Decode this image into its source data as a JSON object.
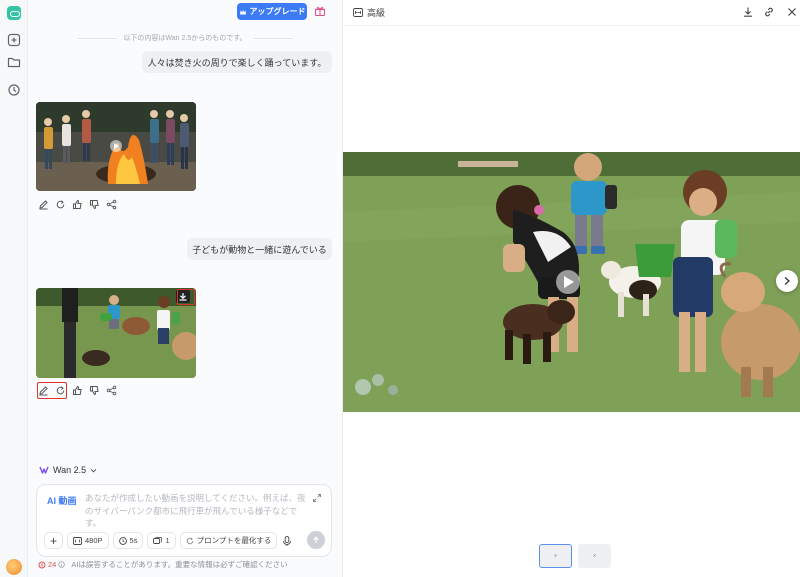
{
  "rail": {
    "icons": [
      "logo-icon",
      "new-chat-icon",
      "folder-icon",
      "history-icon"
    ]
  },
  "header": {
    "upgrade_label": "アップグレード"
  },
  "chat": {
    "notice": "以下の内容はWan 2.5からのものです。",
    "messages": [
      {
        "role": "user",
        "text": "人々は焚き火の周りで楽しく踊っています。"
      },
      {
        "role": "assistant",
        "type": "video",
        "scene": "bonfire-dance"
      },
      {
        "role": "user",
        "text": "子どもが動物と一緒に遊んでいる"
      },
      {
        "role": "assistant",
        "type": "video",
        "scene": "children-with-goats"
      }
    ]
  },
  "composer": {
    "model_label": "Wan 2.5",
    "mode_label": "AI 動画",
    "placeholder": "あなたが作成したい動画を説明してください。例えば、夜のサイバーパンク都市に飛行車が飛んでいる様子などです。",
    "chips": {
      "resolution": "480P",
      "duration": "5s",
      "count": "1",
      "optimize": "プロンプトを最化する"
    }
  },
  "footer": {
    "credits": "24",
    "disclaimer": "AIは誤答することがあります。重要な情報は必ずご確認ください"
  },
  "preview": {
    "quality_label": "高級"
  },
  "colors": {
    "accent": "#3d7bf5",
    "highlight": "#e0302a",
    "credits": "#e0504d"
  }
}
